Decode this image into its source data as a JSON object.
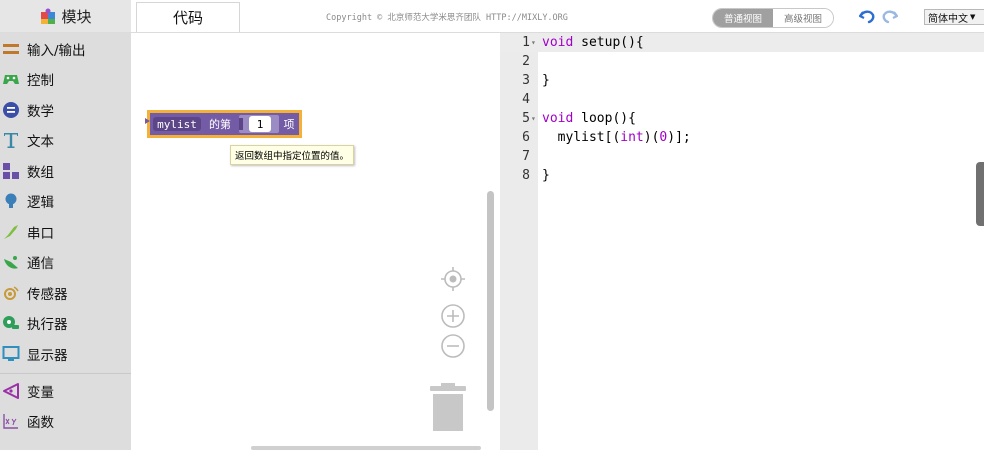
{
  "header": {
    "modules_tab": "模块",
    "code_tab": "代码",
    "copyright": "Copyright © 北京师范大学米思齐团队 HTTP://MIXLY.ORG",
    "view_normal": "普通视图",
    "view_advanced": "高级视图",
    "language": "简体中文"
  },
  "sidebar": {
    "items": [
      {
        "label": "输入/输出",
        "icon": "io-arrows-icon",
        "color": "#c0792a"
      },
      {
        "label": "控制",
        "icon": "gamepad-icon",
        "color": "#3aa64a"
      },
      {
        "label": "数学",
        "icon": "math-icon",
        "color": "#3b4ea8"
      },
      {
        "label": "文本",
        "icon": "text-icon",
        "color": "#3b87a8"
      },
      {
        "label": "数组",
        "icon": "array-icon",
        "color": "#6a4fa8"
      },
      {
        "label": "逻辑",
        "icon": "bulb-icon",
        "color": "#3b7fb8"
      },
      {
        "label": "串口",
        "icon": "serial-icon",
        "color": "#7fbf3f"
      },
      {
        "label": "通信",
        "icon": "satellite-icon",
        "color": "#3aa64a"
      },
      {
        "label": "传感器",
        "icon": "sensor-icon",
        "color": "#c79a3a"
      },
      {
        "label": "执行器",
        "icon": "actuator-icon",
        "color": "#2e9e5a"
      },
      {
        "label": "显示器",
        "icon": "display-icon",
        "color": "#2f8fbf"
      },
      {
        "label": "变量",
        "icon": "variable-icon",
        "color": "#9b2fa8"
      },
      {
        "label": "函数",
        "icon": "function-icon",
        "color": "#8b4fa8"
      }
    ]
  },
  "workspace": {
    "block": {
      "variable": "mylist",
      "prefix": "的第",
      "index": "1",
      "suffix": "项",
      "color": "#745ba5",
      "highlight": "#f4b13a"
    },
    "tooltip": "返回数组中指定位置的值。"
  },
  "editor": {
    "lines": [
      {
        "n": "1",
        "fold": "▾",
        "segments": [
          {
            "t": "void",
            "c": "kw"
          },
          {
            "t": " setup(){",
            "c": ""
          }
        ]
      },
      {
        "n": "2",
        "fold": "",
        "segments": []
      },
      {
        "n": "3",
        "fold": "",
        "segments": [
          {
            "t": "}",
            "c": ""
          }
        ]
      },
      {
        "n": "4",
        "fold": "",
        "segments": []
      },
      {
        "n": "5",
        "fold": "▾",
        "segments": [
          {
            "t": "void",
            "c": "kw"
          },
          {
            "t": " loop(){",
            "c": ""
          }
        ]
      },
      {
        "n": "6",
        "fold": "",
        "segments": [
          {
            "t": "  mylist[(",
            "c": ""
          },
          {
            "t": "int",
            "c": "kw"
          },
          {
            "t": ")(",
            "c": ""
          },
          {
            "t": "0",
            "c": "num"
          },
          {
            "t": ")];",
            "c": ""
          }
        ]
      },
      {
        "n": "7",
        "fold": "",
        "segments": []
      },
      {
        "n": "8",
        "fold": "",
        "segments": [
          {
            "t": "}",
            "c": ""
          }
        ]
      }
    ]
  }
}
